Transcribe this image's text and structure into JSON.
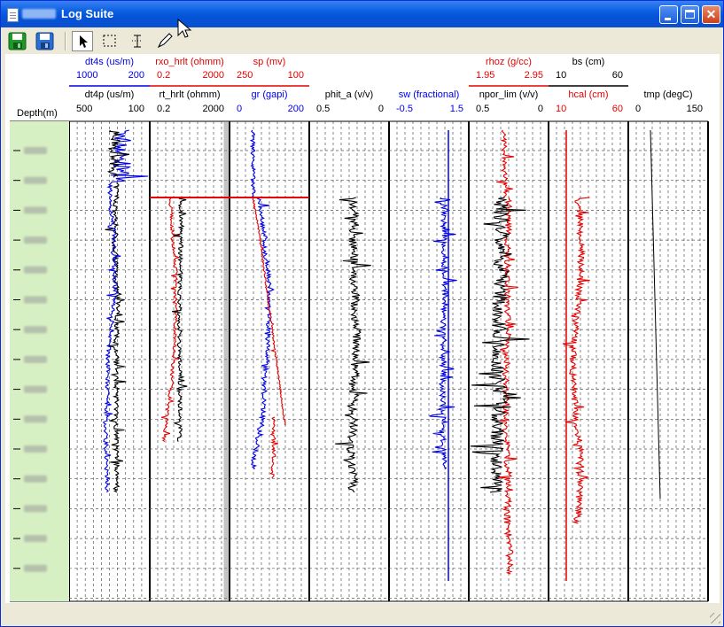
{
  "window": {
    "title": "Log Suite"
  },
  "toolbar": {
    "tools": [
      "save-icon",
      "save-as-icon",
      "pointer-icon",
      "select-rect-icon",
      "ibeam-icon",
      "pen-icon"
    ]
  },
  "colors": {
    "black": "#000000",
    "red": "#e60000",
    "blue": "#0000e6",
    "depth_bg": "#d7f0c3"
  },
  "depth_header": "Depth(m)",
  "tracks": [
    {
      "id": "t1",
      "headers": [
        {
          "label": "dt4s (us/m)",
          "left": "1000",
          "right": "200",
          "color": "#0000e6"
        },
        {
          "label": "dt4p (us/m)",
          "left": "500",
          "right": "100",
          "color": "#000000"
        }
      ]
    },
    {
      "id": "t2",
      "headers": [
        {
          "label": "rxo_hrlt (ohmm)",
          "left": "0.2",
          "right": "2000",
          "color": "#e60000"
        },
        {
          "label": "rt_hrlt (ohmm)",
          "left": "0.2",
          "right": "2000",
          "color": "#000000"
        }
      ]
    },
    {
      "id": "t3",
      "headers": [
        {
          "label": "sp (mv)",
          "left": "250",
          "right": "100",
          "color": "#e60000"
        },
        {
          "label": "gr (gapi)",
          "left": "0",
          "right": "200",
          "color": "#0000e6"
        }
      ]
    },
    {
      "id": "t4",
      "headers": [
        {
          "label": "phit_a (v/v)",
          "left": "0.5",
          "right": "0",
          "color": "#000000"
        }
      ]
    },
    {
      "id": "t5",
      "headers": [
        {
          "label": "sw (fractional)",
          "left": "-0.5",
          "right": "1.5",
          "color": "#0000e6"
        }
      ]
    },
    {
      "id": "t6",
      "headers": [
        {
          "label": "rhoz (g/cc)",
          "left": "1.95",
          "right": "2.95",
          "color": "#e60000"
        },
        {
          "label": "npor_lim (v/v)",
          "left": "0.5",
          "right": "0",
          "color": "#000000"
        }
      ]
    },
    {
      "id": "t7",
      "headers": [
        {
          "label": "bs (cm)",
          "left": "10",
          "right": "60",
          "color": "#000000"
        },
        {
          "label": "hcal (cm)",
          "left": "10",
          "right": "60",
          "color": "#e60000"
        }
      ]
    },
    {
      "id": "t8",
      "headers": [
        {
          "label": "tmp (degC)",
          "left": "0",
          "right": "150",
          "color": "#000000"
        }
      ]
    }
  ]
}
